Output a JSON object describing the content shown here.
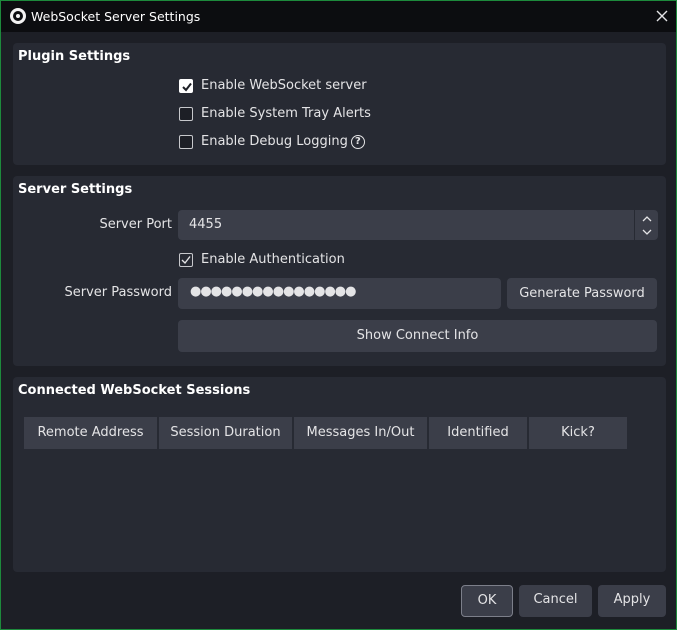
{
  "window": {
    "title": "WebSocket Server Settings",
    "accent": "#1d8a3c"
  },
  "plugin_settings": {
    "title": "Plugin Settings",
    "enable_server": {
      "label": "Enable WebSocket server",
      "checked": true
    },
    "tray_alerts": {
      "label": "Enable System Tray Alerts",
      "checked": false
    },
    "debug_logging": {
      "label": "Enable Debug Logging",
      "checked": false,
      "help_icon": "?"
    }
  },
  "server_settings": {
    "title": "Server Settings",
    "port_label": "Server Port",
    "port_value": "4455",
    "auth": {
      "label": "Enable Authentication",
      "checked": true
    },
    "password_label": "Server Password",
    "password_value": "●●●●●●●●●●●●●●●●",
    "generate_label": "Generate Password",
    "connect_info_label": "Show Connect Info"
  },
  "sessions": {
    "title": "Connected WebSocket Sessions",
    "columns": [
      "Remote Address",
      "Session Duration",
      "Messages In/Out",
      "Identified",
      "Kick?"
    ]
  },
  "buttons": {
    "ok": "OK",
    "cancel": "Cancel",
    "apply": "Apply"
  }
}
